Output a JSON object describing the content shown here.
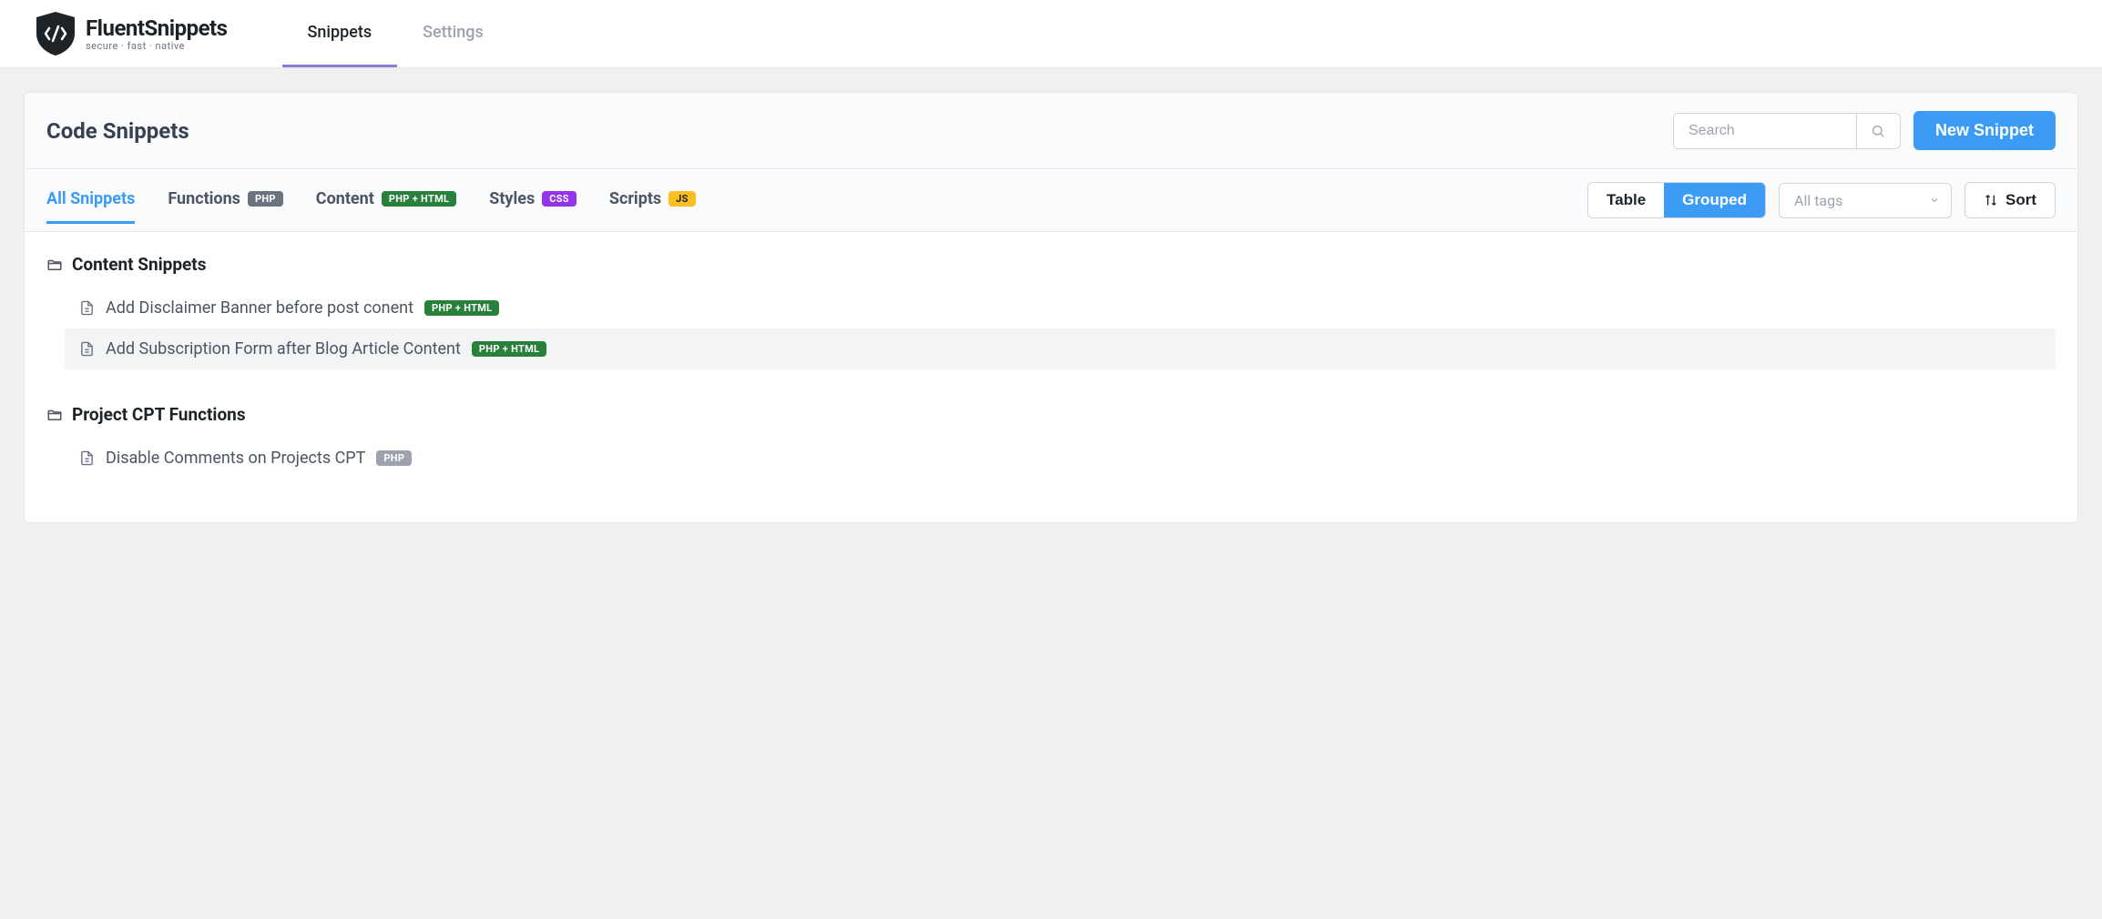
{
  "logo": {
    "main": "FluentSnippets",
    "sub": "secure · fast · native"
  },
  "nav": [
    {
      "label": "Snippets",
      "active": true
    },
    {
      "label": "Settings",
      "active": false
    }
  ],
  "page_title": "Code Snippets",
  "search": {
    "placeholder": "Search"
  },
  "new_snippet_label": "New Snippet",
  "filter_tabs": [
    {
      "label": "All Snippets",
      "badge": null,
      "active": true
    },
    {
      "label": "Functions",
      "badge": "PHP",
      "badge_class": "badge-php",
      "active": false
    },
    {
      "label": "Content",
      "badge": "PHP + HTML",
      "badge_class": "badge-phphtml",
      "active": false
    },
    {
      "label": "Styles",
      "badge": "CSS",
      "badge_class": "badge-css",
      "active": false
    },
    {
      "label": "Scripts",
      "badge": "JS",
      "badge_class": "badge-js",
      "active": false
    }
  ],
  "view_toggle": {
    "table": "Table",
    "grouped": "Grouped",
    "active": "grouped"
  },
  "tags_placeholder": "All tags",
  "sort_label": "Sort",
  "groups": [
    {
      "title": "Content Snippets",
      "items": [
        {
          "name": "Add Disclaimer Banner before post conent",
          "badge": "PHP + HTML",
          "badge_class": "badge-phphtml",
          "hovered": false
        },
        {
          "name": "Add Subscription Form after Blog Article Content",
          "badge": "PHP + HTML",
          "badge_class": "badge-phphtml",
          "hovered": true
        }
      ]
    },
    {
      "title": "Project CPT Functions",
      "items": [
        {
          "name": "Disable Comments on Projects CPT",
          "badge": "PHP",
          "badge_class": "badge-php-light",
          "hovered": false
        }
      ]
    }
  ]
}
